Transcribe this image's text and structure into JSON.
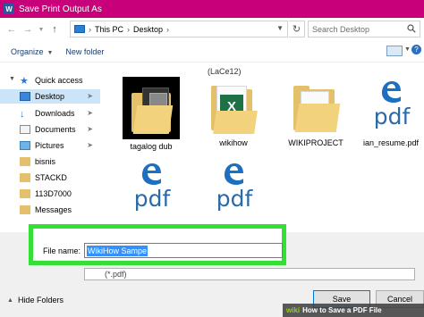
{
  "window": {
    "title": "Save Print Output As",
    "app_icon_letter": "W"
  },
  "address": {
    "back_icon": "arrow-left-icon",
    "forward_icon": "arrow-right-icon",
    "up_icon": "arrow-up-icon",
    "crumbs": [
      "This PC",
      "Desktop"
    ],
    "search_placeholder": "Search Desktop"
  },
  "toolbar": {
    "organize_label": "Organize",
    "new_folder_label": "New folder"
  },
  "nav": {
    "items": [
      {
        "label": "Quick access"
      },
      {
        "label": "Desktop"
      },
      {
        "label": "Downloads"
      },
      {
        "label": "Documents"
      },
      {
        "label": "Pictures"
      },
      {
        "label": "bisnis"
      },
      {
        "label": "STACKD"
      },
      {
        "label": "113D7000"
      },
      {
        "label": "Messages"
      }
    ]
  },
  "files": {
    "group_header": "(LaCe12)",
    "items": [
      {
        "label": "tagalog dub",
        "type": "folder-media"
      },
      {
        "label": "wikihow",
        "type": "folder-excel"
      },
      {
        "label": "WIKIPROJECT",
        "type": "folder"
      },
      {
        "label": "ian_resume.pdf",
        "type": "pdf"
      },
      {
        "label": "",
        "type": "pdf"
      },
      {
        "label": "",
        "type": "pdf"
      }
    ],
    "pdf_text": "pdf",
    "excel_letter": "X"
  },
  "save": {
    "file_name_label": "File name:",
    "file_name_value": "WikiHow Sampe",
    "save_type_value": "(*.pdf)"
  },
  "footer": {
    "hide_folders_label": "Hide Folders",
    "save_label": "Save",
    "cancel_label": "Cancel"
  },
  "watermark": {
    "logo": "wiki",
    "text": "How to Save a PDF File"
  },
  "colors": {
    "titlebar": "#c8007a",
    "highlight": "#34e035",
    "selection": "#3390ff",
    "folder": "#e5c06a"
  }
}
